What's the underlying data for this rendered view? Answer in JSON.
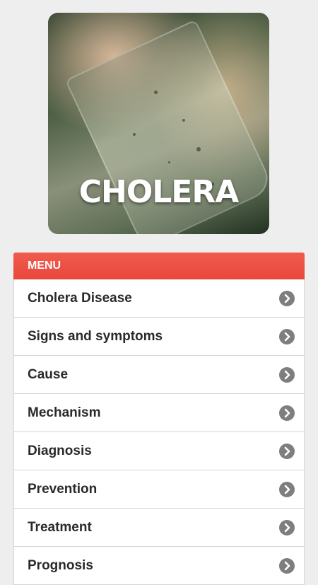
{
  "hero": {
    "title": "CHOLERA",
    "icon": "cholera-hero-image"
  },
  "menu": {
    "header": "MENU",
    "accent_color": "#e8473c",
    "chevron_icon": "chevron-right-circle-icon",
    "items": [
      {
        "label": "Cholera Disease"
      },
      {
        "label": "Signs and symptoms"
      },
      {
        "label": "Cause"
      },
      {
        "label": "Mechanism"
      },
      {
        "label": "Diagnosis"
      },
      {
        "label": "Prevention"
      },
      {
        "label": "Treatment"
      },
      {
        "label": "Prognosis"
      }
    ]
  }
}
